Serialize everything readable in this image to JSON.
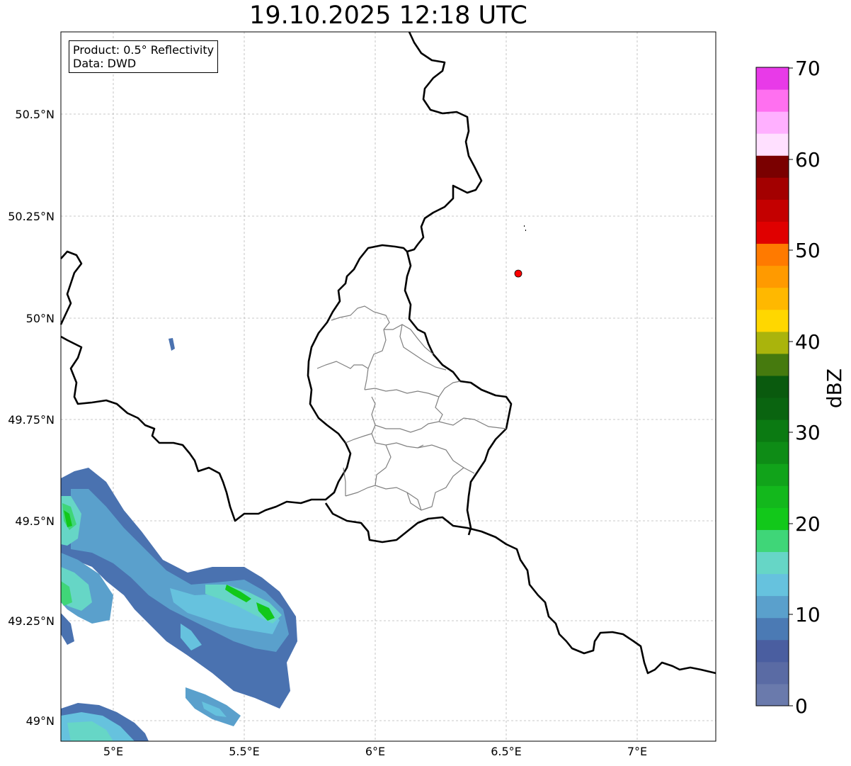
{
  "title": "19.10.2025 12:18 UTC",
  "info": {
    "product": "Product: 0.5° Reflectivity",
    "data": "Data: DWD"
  },
  "axes": {
    "lat_ticks": [
      "50.5°N",
      "50.25°N",
      "50°N",
      "49.75°N",
      "49.5°N",
      "49.25°N",
      "49°N"
    ],
    "lon_ticks": [
      "5°E",
      "5.5°E",
      "6°E",
      "6.5°E",
      "7°E"
    ],
    "lon_range": [
      4.8,
      7.3
    ],
    "lat_range": [
      48.95,
      50.7
    ]
  },
  "marker": {
    "lon": 6.55,
    "lat": 50.11,
    "color": "#ff0000"
  },
  "colorbar": {
    "label": "dBZ",
    "ticks": [
      "70",
      "60",
      "50",
      "40",
      "30",
      "20",
      "10",
      "0"
    ],
    "colors": [
      "#6a7aac",
      "#5a6ba4",
      "#4a5ea0",
      "#4b7ab4",
      "#5aa0cc",
      "#66c2de",
      "#66d6c6",
      "#3fd678",
      "#12c81a",
      "#13b81c",
      "#11a31a",
      "#0e8c16",
      "#0b7a12",
      "#0a6410",
      "#0a5a0e",
      "#467a0e",
      "#aab40c",
      "#ffd700",
      "#ffb800",
      "#ff9a00",
      "#ff7a00",
      "#e00000",
      "#c40000",
      "#a30000",
      "#7a0000",
      "#ffe0ff",
      "#ffb0ff",
      "#ff70f0",
      "#e83ae8"
    ]
  }
}
